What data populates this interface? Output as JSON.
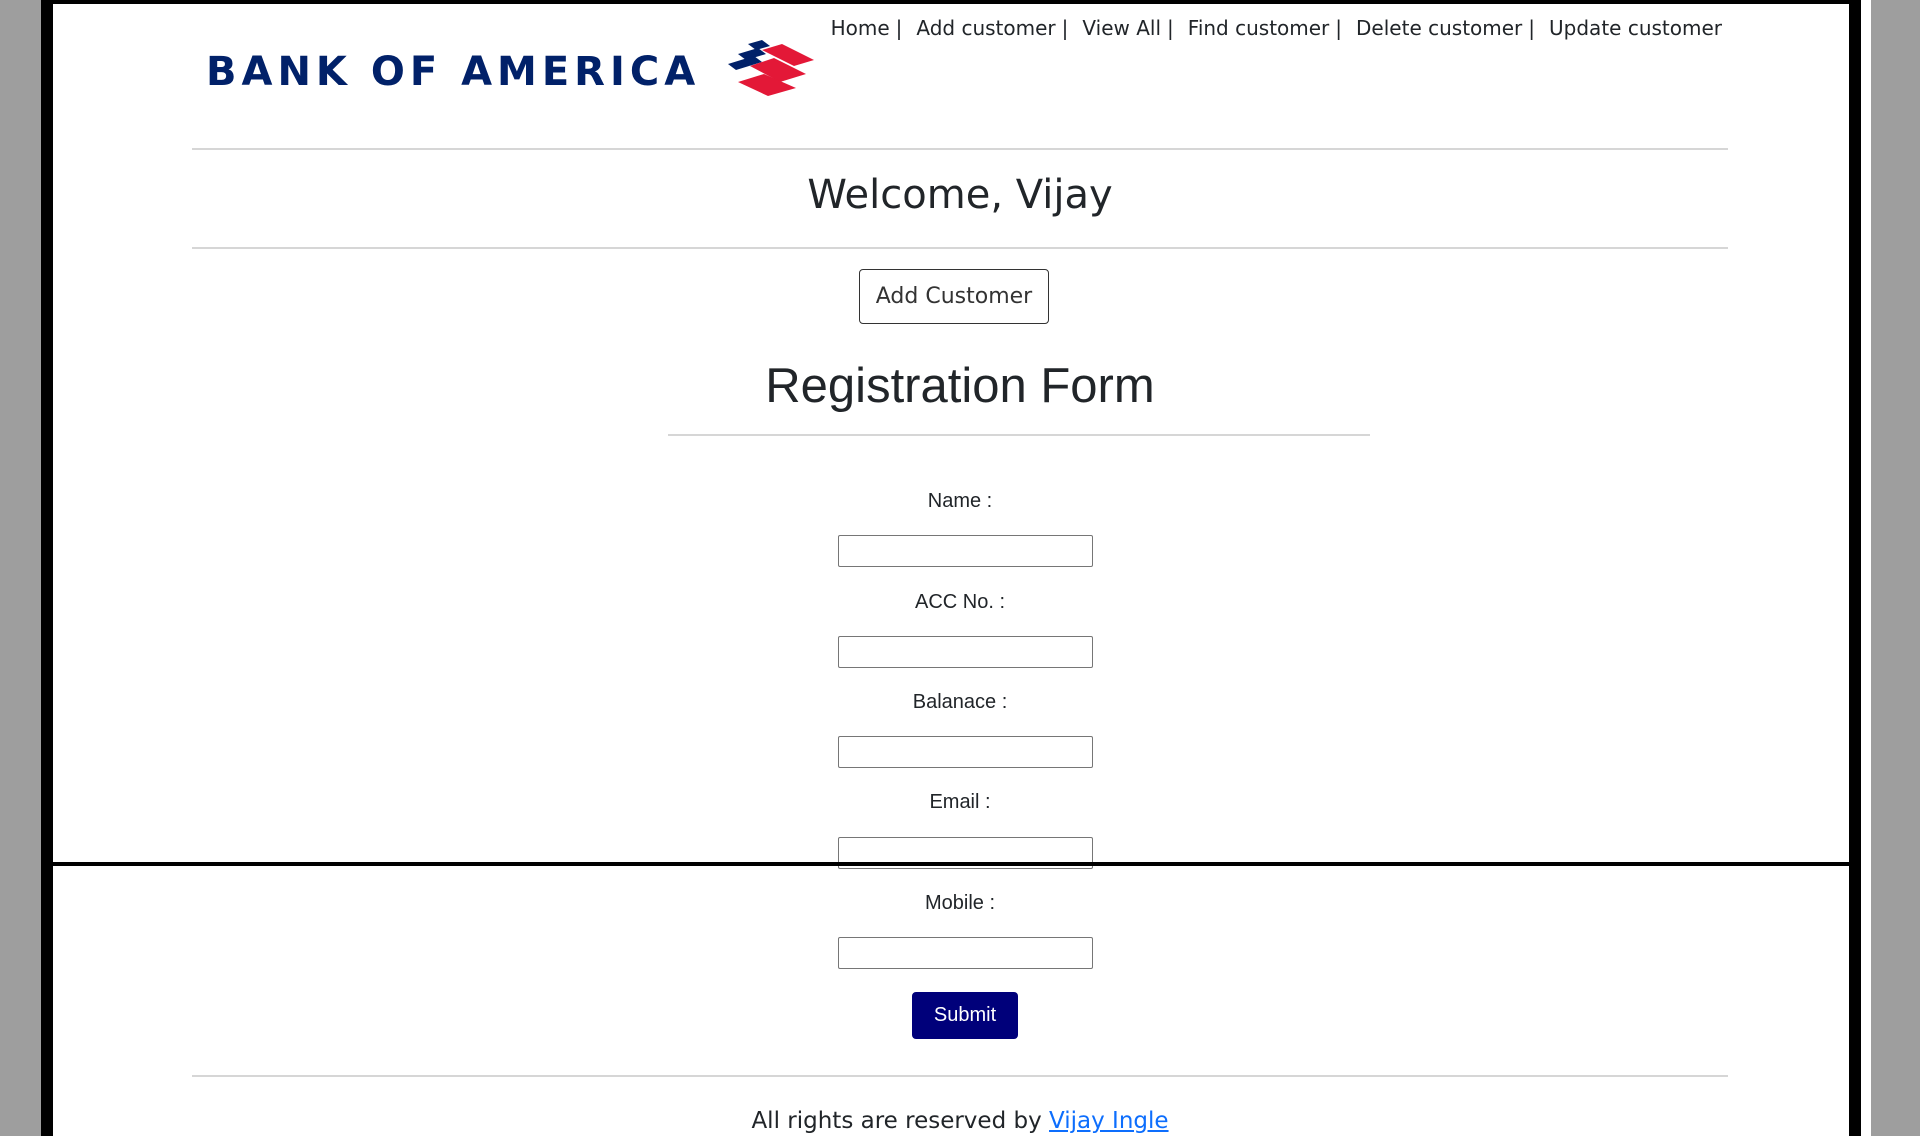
{
  "nav": {
    "items": [
      {
        "label": "Home"
      },
      {
        "label": "Add customer"
      },
      {
        "label": "View All"
      },
      {
        "label": "Find customer"
      },
      {
        "label": "Delete customer"
      },
      {
        "label": "Update customer"
      }
    ],
    "separator": "|"
  },
  "brand": {
    "logo_text": "BANK OF AMERICA",
    "flag_icon": "bank-of-america-flag-icon",
    "colors": {
      "navy": "#012169",
      "red": "#e31837"
    }
  },
  "welcome": {
    "text": "Welcome, Vijay"
  },
  "actions": {
    "add_customer_label": "Add Customer"
  },
  "form": {
    "title": "Registration Form",
    "fields": [
      {
        "label": "Name :",
        "value": ""
      },
      {
        "label": "ACC No. :",
        "value": ""
      },
      {
        "label": "Balanace :",
        "value": ""
      },
      {
        "label": "Email :",
        "value": ""
      },
      {
        "label": "Mobile :",
        "value": ""
      }
    ],
    "submit_label": "Submit",
    "submit_color": "#00007a"
  },
  "footer": {
    "text": "All rights are reserved by",
    "author_link": "Vijay Ingle"
  }
}
